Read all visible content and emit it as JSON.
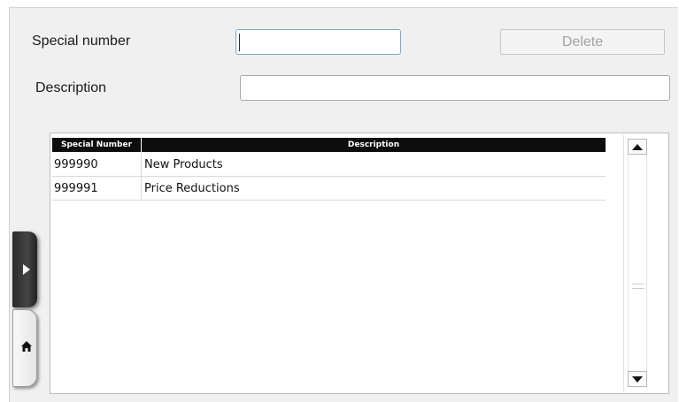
{
  "form": {
    "special_number_label": "Special number",
    "special_number_value": "",
    "description_label": "Description",
    "description_value": "",
    "delete_label": "Delete"
  },
  "table": {
    "columns": [
      "Special Number",
      "Description"
    ],
    "rows": [
      {
        "special_number": "999990",
        "description": "New Products"
      },
      {
        "special_number": "999991",
        "description": "Price Reductions"
      }
    ]
  },
  "side_tabs": {
    "play_icon": "play-icon",
    "home_icon": "home-icon"
  },
  "colors": {
    "header_bg": "#0d0d0d",
    "delete_text_disabled": "#a3a3a3"
  }
}
